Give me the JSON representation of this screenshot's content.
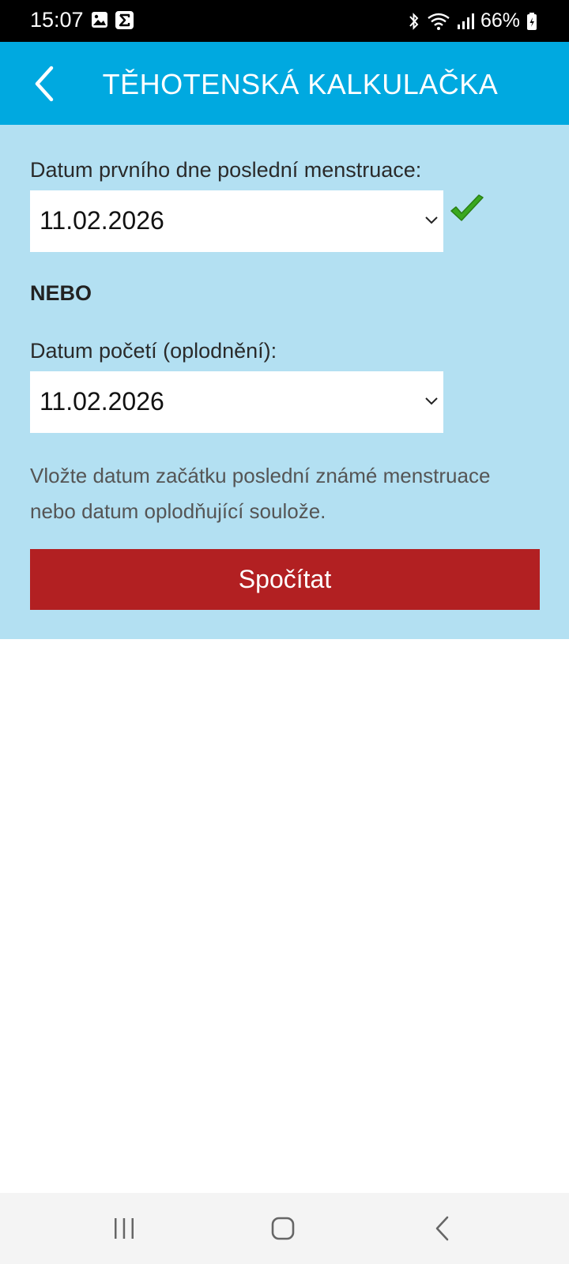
{
  "status_bar": {
    "time": "15:07",
    "battery": "66%",
    "icons": [
      "image-icon",
      "sigma-icon",
      "bluetooth-icon",
      "wifi-icon",
      "signal-icon",
      "battery-icon"
    ]
  },
  "header": {
    "title": "TĚHOTENSKÁ KALKULAČKA",
    "back_icon": "chevron-left-icon"
  },
  "form": {
    "lmp_label": "Datum prvního dne poslední menstruace:",
    "lmp_value": "11.02.2026",
    "or_label": "NEBO",
    "conception_label": "Datum početí (oplodnění):",
    "conception_value": "11.02.2026",
    "hint": "Vložte datum začátku poslední známé menstruace nebo datum oplodňující soulože.",
    "submit_label": "Spočítat"
  },
  "colors": {
    "header_bg": "#00a9e0",
    "panel_bg": "#b3e0f2",
    "button_bg": "#b22022",
    "check": "#3aa81f"
  },
  "nav": {
    "icons": [
      "recent-apps-icon",
      "home-icon",
      "back-icon"
    ]
  }
}
